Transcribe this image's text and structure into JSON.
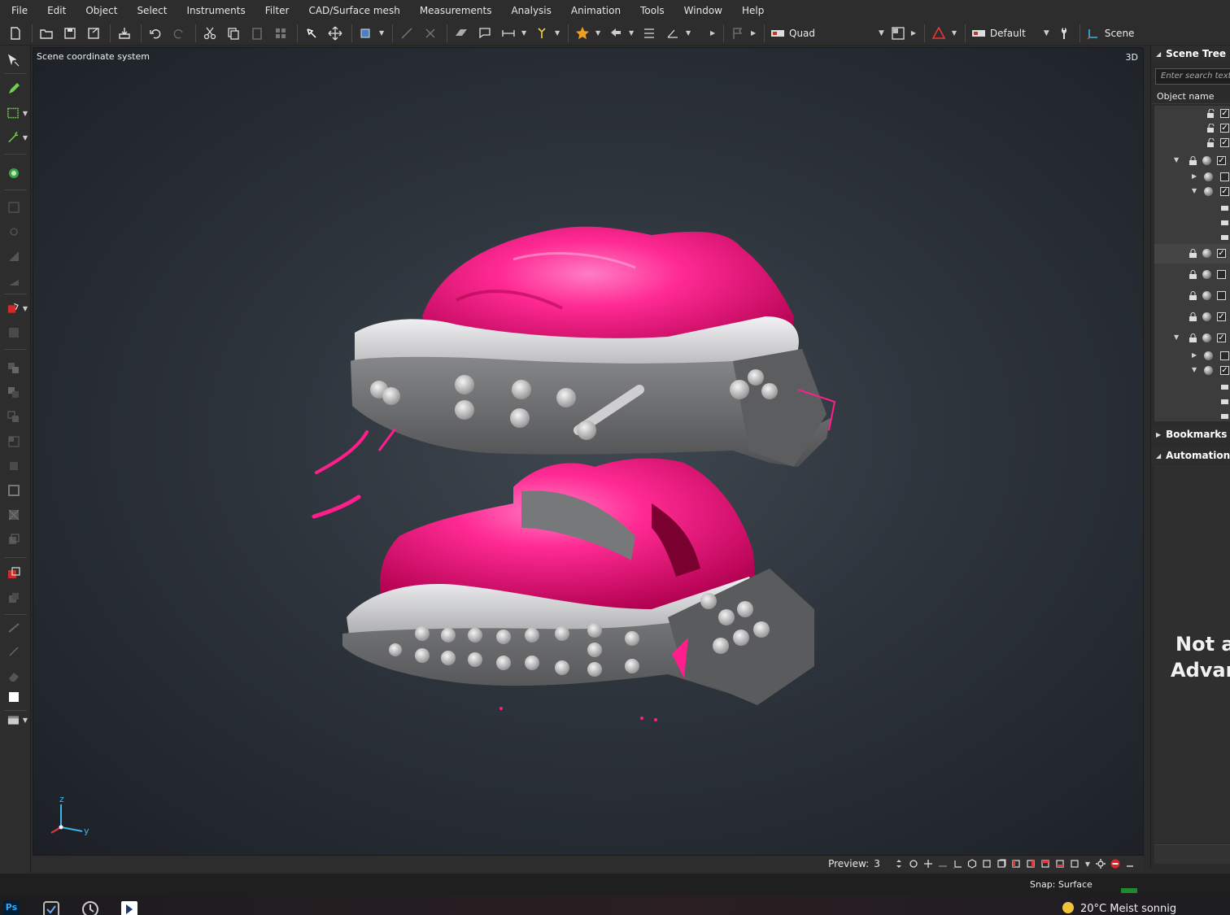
{
  "menu": [
    "File",
    "Edit",
    "Object",
    "Select",
    "Instruments",
    "Filter",
    "CAD/Surface mesh",
    "Measurements",
    "Analysis",
    "Animation",
    "Tools",
    "Window",
    "Help"
  ],
  "toolbar": {
    "layout_combo": "Quad",
    "style_combo": "Default",
    "scene_label": "Scene"
  },
  "viewport": {
    "label": "Scene coordinate system",
    "mode": "3D",
    "axis": {
      "z": "z",
      "y": "y"
    },
    "preview_label": "Preview:",
    "preview_value": "3"
  },
  "right_panel": {
    "scene_tree_title": "Scene Tree",
    "search_placeholder": "Enter search text h",
    "column_header": "Object name",
    "bookmarks_title": "Bookmarks",
    "automation_title": "Automation",
    "automation_msg_line1": "Not a",
    "automation_msg_line2": "Advar"
  },
  "status": {
    "snap": "Snap: Surface"
  },
  "taskbar": {
    "weather": "20°C  Meist sonnig",
    "ps_label": "Ps"
  },
  "colors": {
    "accent_pink": "#ff1e8c",
    "tray_gray": "#6d6e70",
    "rim_white": "#d6d6d8",
    "snap_green": "#1e8a2e"
  }
}
